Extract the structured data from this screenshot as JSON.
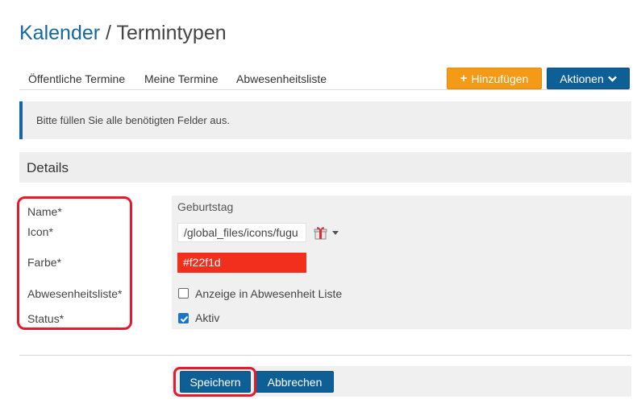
{
  "breadcrumb": {
    "parent": "Kalender",
    "separator": " / ",
    "current": "Termintypen"
  },
  "subnav": {
    "tabs": [
      {
        "label": "Öffentliche Termine"
      },
      {
        "label": "Meine Termine"
      },
      {
        "label": "Abwesenheitsliste"
      }
    ],
    "add_button": {
      "icon": "plus-icon",
      "label": "Hinzufügen"
    },
    "actions_button": {
      "label": "Aktionen",
      "icon": "chevron-down-icon"
    }
  },
  "alert": {
    "text": "Bitte füllen Sie alle benötigten Felder aus."
  },
  "details": {
    "title": "Details"
  },
  "form": {
    "labels": {
      "name": "Name*",
      "icon": "Icon*",
      "color": "Farbe*",
      "absence_list": "Abwesenheitsliste*",
      "status": "Status*"
    },
    "name_value": "Geburtstag",
    "icon_path": "/global_files/icons/fugu",
    "icon_preview": "gift-icon",
    "color_value": "#f22f1d",
    "absence_checkbox": {
      "label": "Anzeige in Abwesenheit Liste",
      "checked": false
    },
    "status_checkbox": {
      "label": "Aktiv",
      "checked": true
    }
  },
  "footer": {
    "save_label": "Speichern",
    "cancel_label": "Abbrechen"
  },
  "colors": {
    "primary": "#0e5f96",
    "accent": "#f59a17",
    "link": "#1467a0",
    "annotation": "#e8182d"
  }
}
